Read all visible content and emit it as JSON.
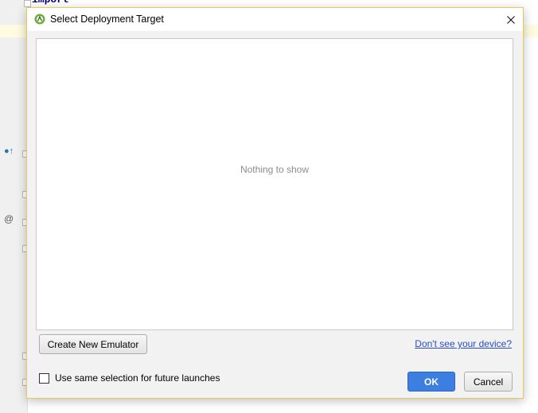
{
  "background": {
    "code_keyword": "import"
  },
  "dialog": {
    "title": "Select Deployment Target",
    "close_glyph": "✕",
    "device_list": {
      "empty_text": "Nothing to show"
    },
    "create_emulator_label": "Create New Emulator",
    "help_link": "Don't see your device?",
    "checkbox": {
      "label": "Use same selection for future launches",
      "checked": false
    },
    "ok_label": "OK",
    "cancel_label": "Cancel"
  },
  "colors": {
    "accent": "#3d7fe0",
    "link": "#2a4bcd",
    "dialog_border": "#e7c95b"
  },
  "icons": {
    "app": "android-studio-icon",
    "close": "close-icon"
  }
}
